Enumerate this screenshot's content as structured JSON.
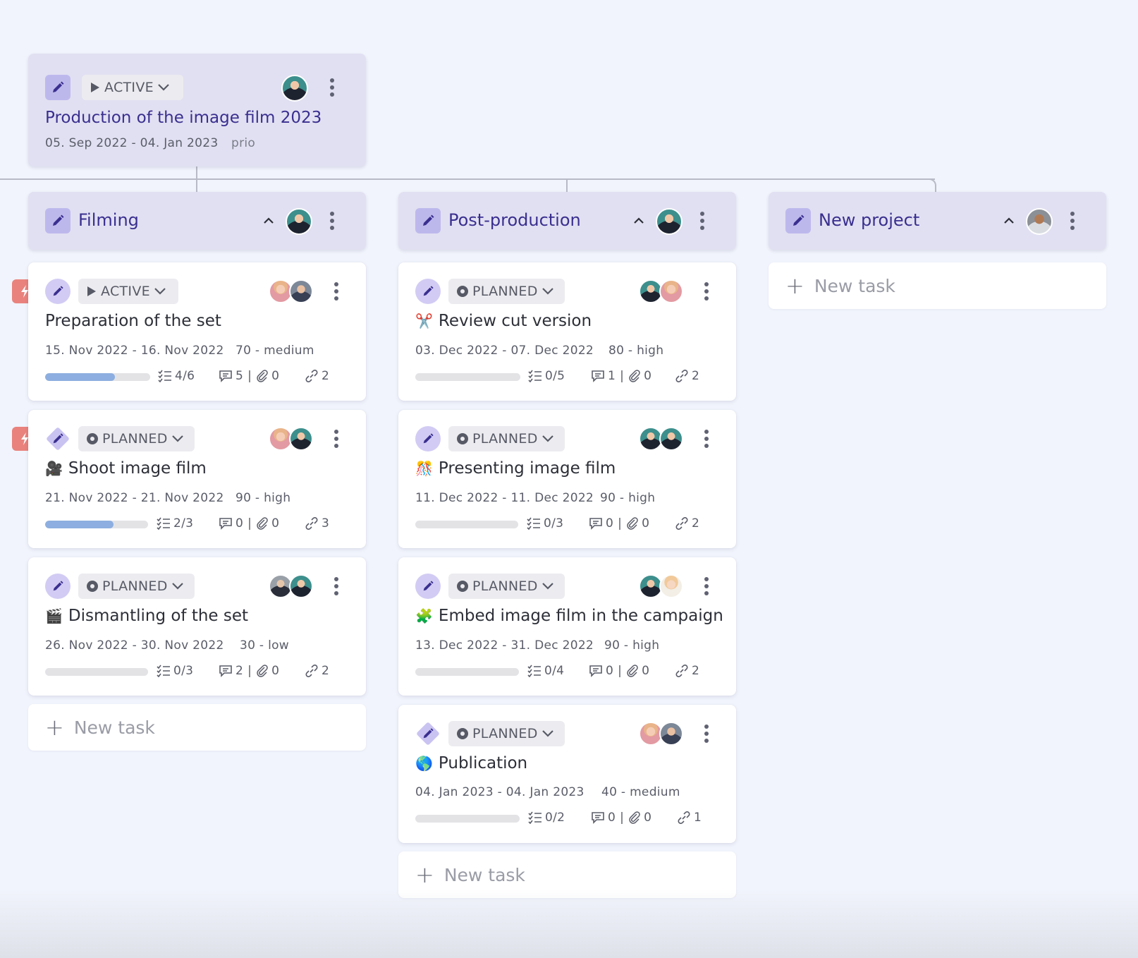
{
  "colors": {
    "accent": "#3a2f8f",
    "phase_bg": "#e1e0f2",
    "progress_fill": "#8daee0",
    "priority_flag": "#e9827d",
    "background": "#f1f4fc"
  },
  "project": {
    "status": "ACTIVE",
    "title": "Production of the image film 2023",
    "dates": "05. Sep 2022 - 04. Jan 2023",
    "priority": "prio"
  },
  "phases": [
    {
      "title": "Filming",
      "new_task_label": "New task",
      "tasks": [
        {
          "status": "ACTIVE",
          "icon": "",
          "title": "Preparation of the set",
          "dates": "15. Nov 2022 - 16. Nov 2022",
          "priority": "70 - medium",
          "progress": 0.667,
          "checklist": "4/6",
          "comments": "5",
          "attachments": "0",
          "links": "2",
          "flag": true
        },
        {
          "status": "PLANNED",
          "icon": "🎥",
          "title": "Shoot image film",
          "dates": "21. Nov 2022 - 21. Nov 2022",
          "priority": "90 - high",
          "progress": 0.667,
          "checklist": "2/3",
          "comments": "0",
          "attachments": "0",
          "links": "3",
          "flag": true
        },
        {
          "status": "PLANNED",
          "icon": "🎬",
          "title": "Dismantling of the set",
          "dates": "26. Nov 2022 - 30. Nov 2022",
          "priority": "30 - low",
          "progress": 0,
          "checklist": "0/3",
          "comments": "2",
          "attachments": "0",
          "links": "2",
          "flag": false
        }
      ]
    },
    {
      "title": "Post-production",
      "new_task_label": "New task",
      "tasks": [
        {
          "status": "PLANNED",
          "icon": "✂️",
          "title": "Review cut version",
          "dates": "03. Dec 2022 - 07. Dec 2022",
          "priority": "80 - high",
          "progress": 0,
          "checklist": "0/5",
          "comments": "1",
          "attachments": "0",
          "links": "2"
        },
        {
          "status": "PLANNED",
          "icon": "🎊",
          "title": "Presenting image film",
          "dates": "11. Dec 2022 - 11. Dec 2022",
          "priority": "90 - high",
          "progress": 0,
          "checklist": "0/3",
          "comments": "0",
          "attachments": "0",
          "links": "2"
        },
        {
          "status": "PLANNED",
          "icon": "🧩",
          "title": "Embed image film in the campaign",
          "dates": "13. Dec 2022 - 31. Dec 2022",
          "priority": "90 - high",
          "progress": 0,
          "checklist": "0/4",
          "comments": "0",
          "attachments": "0",
          "links": "2"
        },
        {
          "status": "PLANNED",
          "icon": "🌎",
          "title": "Publication",
          "dates": "04. Jan 2023 - 04. Jan 2023",
          "priority": "40 - medium",
          "progress": 0,
          "checklist": "0/2",
          "comments": "0",
          "attachments": "0",
          "links": "1"
        }
      ]
    },
    {
      "title": "New project",
      "new_task_label": "New task",
      "tasks": []
    }
  ]
}
